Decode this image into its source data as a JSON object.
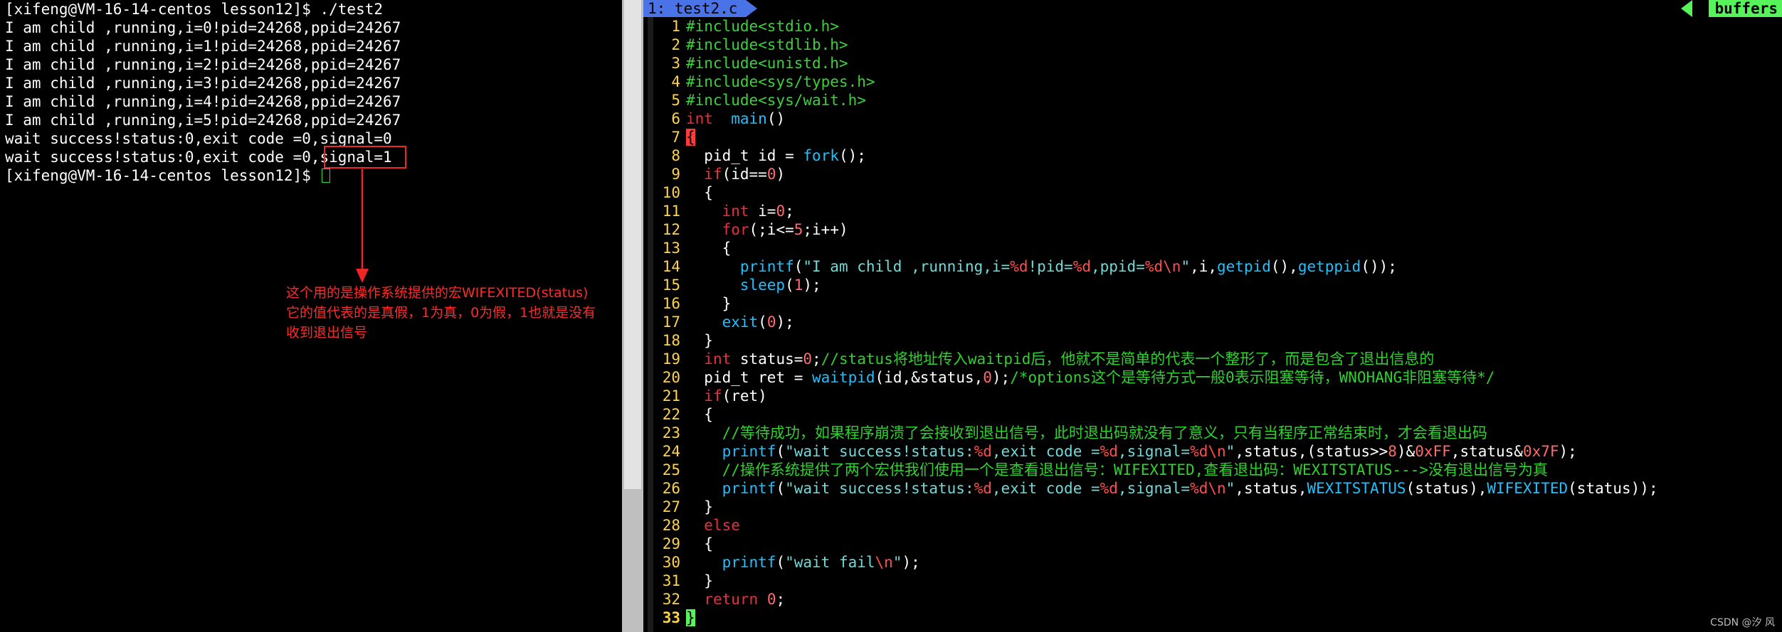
{
  "terminal": {
    "lines": [
      "[xifeng@VM-16-14-centos lesson12]$ ./test2",
      "I am child ,running,i=0!pid=24268,ppid=24267",
      "I am child ,running,i=1!pid=24268,ppid=24267",
      "I am child ,running,i=2!pid=24268,ppid=24267",
      "I am child ,running,i=3!pid=24268,ppid=24267",
      "I am child ,running,i=4!pid=24268,ppid=24267",
      "I am child ,running,i=5!pid=24268,ppid=24267",
      "wait success!status:0,exit code =0,signal=0",
      "wait success!status:0,exit code =0,signal=1",
      "[xifeng@VM-16-14-centos lesson12]$ "
    ]
  },
  "annotation": {
    "lines": [
      "这个用的是操作系统提供的宏WIFEXITED(status)",
      "它的值代表的是真假，1为真，0为假，1也就是没有",
      "收到退出信号"
    ]
  },
  "editor": {
    "tab_label": "1: test2.c",
    "buffers_label": "buffers",
    "line_numbers": [
      "1",
      "2",
      "3",
      "4",
      "5",
      "6",
      "7",
      "8",
      "9",
      "10",
      "11",
      "12",
      "13",
      "14",
      "15",
      "16",
      "17",
      "18",
      "19",
      "20",
      "21",
      "22",
      "23",
      "24",
      "25",
      "26",
      "27",
      "28",
      "29",
      "30",
      "31",
      "32",
      "33"
    ],
    "code": [
      [
        [
          "pp",
          "#include<stdio.h>"
        ]
      ],
      [
        [
          "pp",
          "#include<stdlib.h>"
        ]
      ],
      [
        [
          "pp",
          "#include<unistd.h>"
        ]
      ],
      [
        [
          "pp",
          "#include<sys/types.h>"
        ]
      ],
      [
        [
          "pp",
          "#include<sys/wait.h>"
        ]
      ],
      [
        [
          "kw",
          "int"
        ],
        [
          "",
          "  "
        ],
        [
          "fn",
          "main"
        ],
        [
          "",
          "()"
        ]
      ],
      [
        [
          "brace",
          "{"
        ]
      ],
      [
        [
          "",
          "  pid_t id = "
        ],
        [
          "fn",
          "fork"
        ],
        [
          "",
          "();"
        ]
      ],
      [
        [
          "",
          "  "
        ],
        [
          "kw",
          "if"
        ],
        [
          "",
          "(id=="
        ],
        [
          "num",
          "0"
        ],
        [
          "",
          ")"
        ]
      ],
      [
        [
          "",
          "  {"
        ]
      ],
      [
        [
          "",
          "    "
        ],
        [
          "kw",
          "int"
        ],
        [
          "",
          " i="
        ],
        [
          "num",
          "0"
        ],
        [
          "",
          ";"
        ]
      ],
      [
        [
          "",
          "    "
        ],
        [
          "kw",
          "for"
        ],
        [
          "",
          "(;i<="
        ],
        [
          "num",
          "5"
        ],
        [
          "",
          ";i++)"
        ]
      ],
      [
        [
          "",
          "    {"
        ]
      ],
      [
        [
          "",
          "      "
        ],
        [
          "fn",
          "printf"
        ],
        [
          "",
          "("
        ],
        [
          "str",
          "\"I am child ,running,i="
        ],
        [
          "fmt",
          "%d"
        ],
        [
          "str",
          "!pid="
        ],
        [
          "fmt",
          "%d"
        ],
        [
          "str",
          ",ppid="
        ],
        [
          "fmt",
          "%d"
        ],
        [
          "fmt",
          "\\n"
        ],
        [
          "str",
          "\""
        ],
        [
          "",
          ",i,"
        ],
        [
          "fn",
          "getpid"
        ],
        [
          "",
          "(),"
        ],
        [
          "fn",
          "getppid"
        ],
        [
          "",
          "());"
        ]
      ],
      [
        [
          "",
          "      "
        ],
        [
          "fn",
          "sleep"
        ],
        [
          "",
          "("
        ],
        [
          "num",
          "1"
        ],
        [
          "",
          "); "
        ]
      ],
      [
        [
          "",
          "    }"
        ]
      ],
      [
        [
          "",
          "    "
        ],
        [
          "fn",
          "exit"
        ],
        [
          "",
          "("
        ],
        [
          "num",
          "0"
        ],
        [
          "",
          ");"
        ]
      ],
      [
        [
          "",
          "  }"
        ]
      ],
      [
        [
          "",
          "  "
        ],
        [
          "kw",
          "int"
        ],
        [
          "",
          " status="
        ],
        [
          "num",
          "0"
        ],
        [
          "",
          ";"
        ],
        [
          "cm",
          "//status将地址传入waitpid后，他就不是简单的代表一个整形了，而是包含了退出信息的"
        ]
      ],
      [
        [
          "",
          "  pid_t ret = "
        ],
        [
          "fn",
          "waitpid"
        ],
        [
          "",
          "(id,&status,"
        ],
        [
          "num",
          "0"
        ],
        [
          "",
          ");"
        ],
        [
          "cm",
          "/*options这个是等待方式一般0表示阻塞等待，WNOHANG非阻塞等待*/"
        ]
      ],
      [
        [
          "",
          "  "
        ],
        [
          "kw",
          "if"
        ],
        [
          "",
          "(ret)"
        ]
      ],
      [
        [
          "",
          "  {"
        ]
      ],
      [
        [
          "",
          "    "
        ],
        [
          "cm",
          "//等待成功，如果程序崩溃了会接收到退出信号，此时退出码就没有了意义，只有当程序正常结束时，才会看退出码"
        ]
      ],
      [
        [
          "",
          "    "
        ],
        [
          "fn",
          "printf"
        ],
        [
          "",
          "("
        ],
        [
          "str",
          "\"wait success!status:"
        ],
        [
          "fmt",
          "%d"
        ],
        [
          "str",
          ",exit code ="
        ],
        [
          "fmt",
          "%d"
        ],
        [
          "str",
          ",signal="
        ],
        [
          "fmt",
          "%d"
        ],
        [
          "fmt",
          "\\n"
        ],
        [
          "str",
          "\""
        ],
        [
          "",
          ",status,(status>>"
        ],
        [
          "num",
          "8"
        ],
        [
          "",
          ")&"
        ],
        [
          "num",
          "0xFF"
        ],
        [
          "",
          ",status&"
        ],
        [
          "num",
          "0x7F"
        ],
        [
          "",
          ");"
        ]
      ],
      [
        [
          "",
          "    "
        ],
        [
          "cm",
          "//操作系统提供了两个宏供我们使用一个是查看退出信号：WIFEXITED,查看退出码：WEXITSTATUS--->没有退出信号为真"
        ]
      ],
      [
        [
          "",
          "    "
        ],
        [
          "fn",
          "printf"
        ],
        [
          "",
          "("
        ],
        [
          "str",
          "\"wait success!status:"
        ],
        [
          "fmt",
          "%d"
        ],
        [
          "str",
          ",exit code ="
        ],
        [
          "fmt",
          "%d"
        ],
        [
          "str",
          ",signal="
        ],
        [
          "fmt",
          "%d"
        ],
        [
          "fmt",
          "\\n"
        ],
        [
          "str",
          "\""
        ],
        [
          "",
          ",status,"
        ],
        [
          "fn",
          "WEXITSTATUS"
        ],
        [
          "",
          "(status),"
        ],
        [
          "fn",
          "WIFEXITED"
        ],
        [
          "",
          "(status));"
        ]
      ],
      [
        [
          "",
          "  }"
        ]
      ],
      [
        [
          "",
          "  "
        ],
        [
          "kw",
          "else"
        ]
      ],
      [
        [
          "",
          "  {"
        ]
      ],
      [
        [
          "",
          "    "
        ],
        [
          "fn",
          "printf"
        ],
        [
          "",
          "("
        ],
        [
          "str",
          "\"wait fail"
        ],
        [
          "fmt",
          "\\n"
        ],
        [
          "str",
          "\""
        ],
        [
          "",
          ");"
        ]
      ],
      [
        [
          "",
          "  }"
        ]
      ],
      [
        [
          "",
          "  "
        ],
        [
          "kw",
          "return"
        ],
        [
          "",
          " "
        ],
        [
          "num",
          "0"
        ],
        [
          "",
          ";"
        ]
      ],
      [
        [
          "brace-g",
          "}"
        ]
      ]
    ]
  },
  "watermark": "CSDN @汐  风"
}
